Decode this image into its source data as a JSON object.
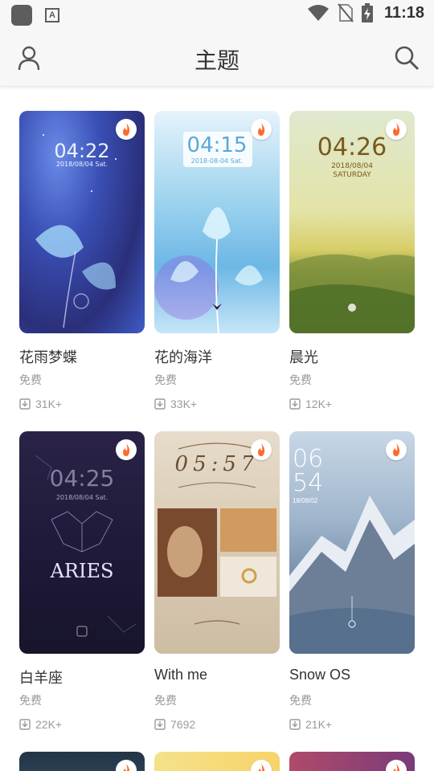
{
  "status_bar": {
    "time": "11:18"
  },
  "header": {
    "title": "主题"
  },
  "themes": [
    {
      "name": "花雨梦蝶",
      "price": "免费",
      "downloads": "31K+",
      "clock": "04:22",
      "date": "2018/08/04  Sat."
    },
    {
      "name": "花的海洋",
      "price": "免费",
      "downloads": "33K+",
      "clock": "04:15",
      "date": "2018-08-04  Sat."
    },
    {
      "name": "晨光",
      "price": "免费",
      "downloads": "12K+",
      "clock": "04:26",
      "date": "2018/08/04",
      "day": "SATURDAY"
    },
    {
      "name": "白羊座",
      "price": "免费",
      "downloads": "22K+",
      "clock": "04:25",
      "date": "2018/08/04  Sat.",
      "badge": "ARIES"
    },
    {
      "name": "With me",
      "price": "免费",
      "downloads": "7692",
      "clock": "05:57"
    },
    {
      "name": "Snow OS",
      "price": "免费",
      "downloads": "21K+",
      "clock_h": "06",
      "clock_m": "54",
      "date": "18/08/02"
    }
  ],
  "colors": {
    "accent": "#ff6a2c",
    "muted": "#9a9a9a"
  }
}
